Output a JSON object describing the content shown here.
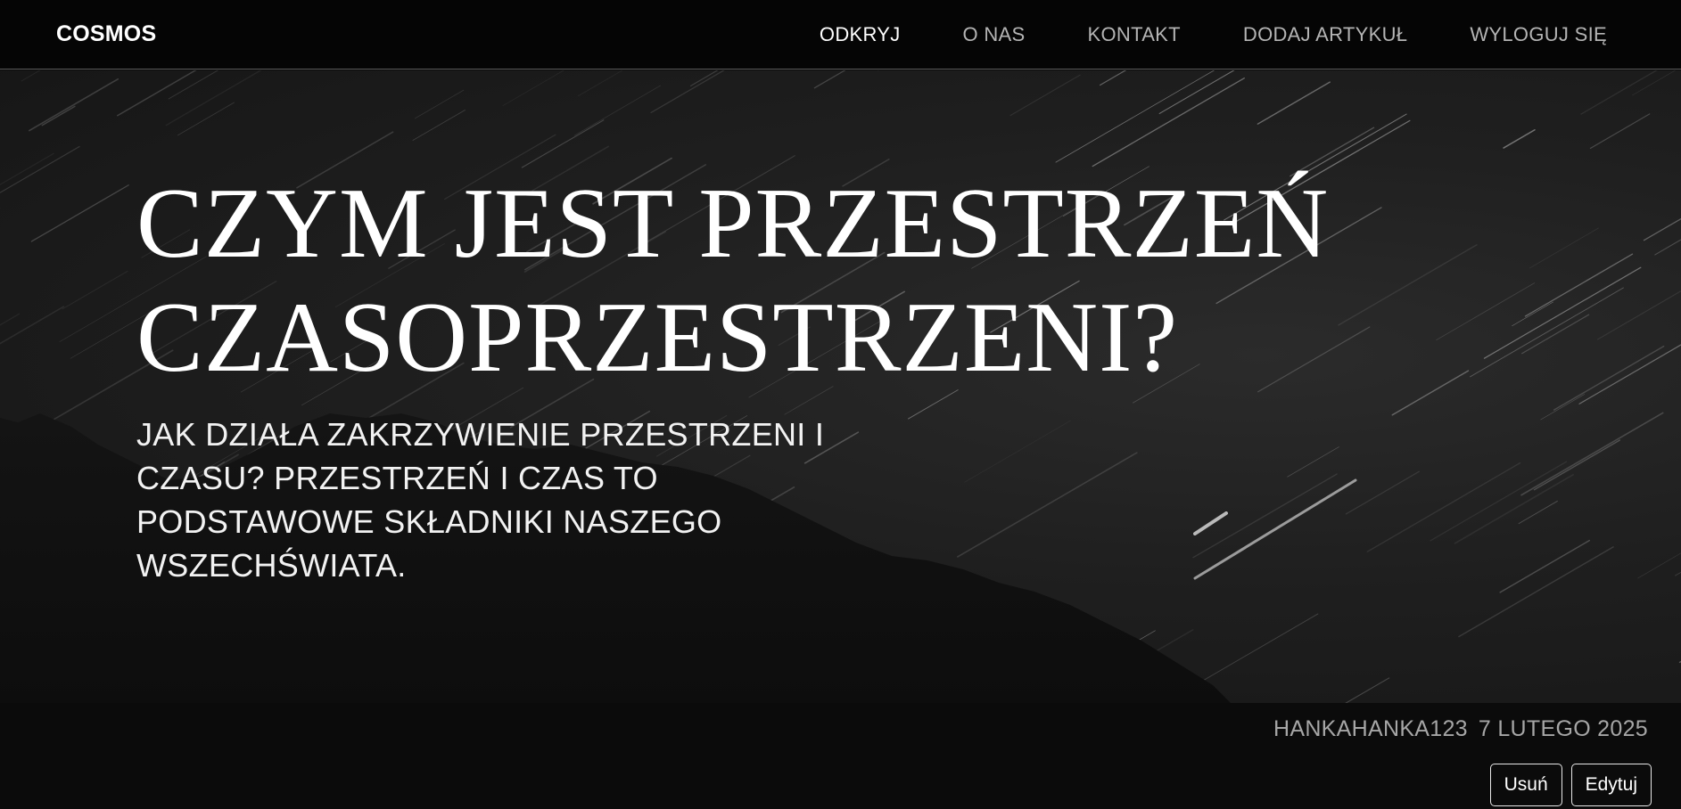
{
  "navbar": {
    "logo": "COSMOS",
    "links": [
      {
        "label": "ODKRYJ",
        "active": true
      },
      {
        "label": "O NAS"
      },
      {
        "label": "KONTAKT"
      },
      {
        "label": "DODAJ ARTYKUŁ"
      },
      {
        "label": "WYLOGUJ SIĘ"
      }
    ]
  },
  "hero": {
    "title_line1": "CZYM JEST PRZESTRZEŃ",
    "title_line2": "CZASOPRZESTRZENI?",
    "subtitle": "JAK DZIAŁA ZAKRZYWIENIE PRZESTRZENI I CZASU? PRZESTRZEŃ I CZAS TO PODSTAWOWE SKŁADNIKI NASZEGO WSZECHŚWIATA."
  },
  "meta": {
    "author": "HANKAHANKA123",
    "date": "7 LUTEGO 2025"
  },
  "actions": {
    "delete_label": "Usuń",
    "edit_label": "Edytuj"
  },
  "colors": {
    "background": "#0b0b0b",
    "navbar": "#050505",
    "text": "#ffffff",
    "muted": "#a6a6a6"
  }
}
